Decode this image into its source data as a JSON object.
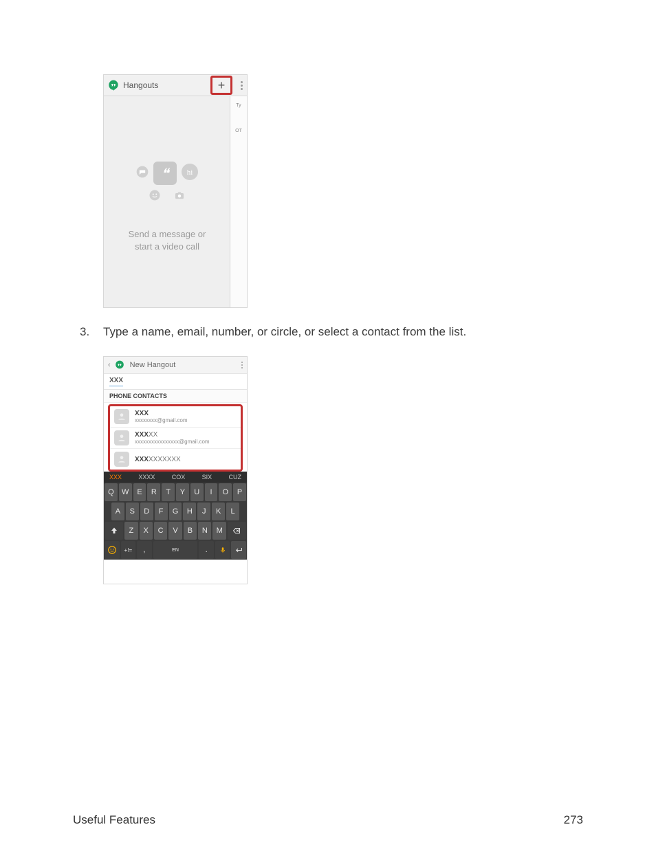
{
  "step": {
    "number": "3.",
    "text": "Type a name, email, number, or circle, or select a contact from the list."
  },
  "footer": {
    "section": "Useful Features",
    "page": "273"
  },
  "shot1": {
    "app_title": "Hangouts",
    "plus_glyph": "+",
    "side": {
      "top": "Ty",
      "section": "OT"
    },
    "hi": "hi",
    "msg_line1": "Send a message or",
    "msg_line2": "start a video call"
  },
  "shot2": {
    "app_title": "New Hangout",
    "search_value": "XXX",
    "section_header": "PHONE CONTACTS",
    "contacts": [
      {
        "name_bold": "XXX",
        "name_light": "",
        "email": "xxxxxxxx@gmail.com"
      },
      {
        "name_bold": "XXX",
        "name_light": "XX",
        "email": "xxxxxxxxxxxxxxxx@gmail.com"
      },
      {
        "name_bold": "XXX",
        "name_light": "XXXXXXX",
        "email": ""
      }
    ],
    "suggestions": [
      "XXX",
      "XXXX",
      "COX",
      "SIX",
      "CUZ"
    ],
    "rows": {
      "r1": [
        "Q",
        "W",
        "E",
        "R",
        "T",
        "Y",
        "U",
        "I",
        "O",
        "P"
      ],
      "r2": [
        "A",
        "S",
        "D",
        "F",
        "G",
        "H",
        "J",
        "K",
        "L"
      ],
      "r3": [
        "Z",
        "X",
        "C",
        "V",
        "B",
        "N",
        "M"
      ],
      "bottom": {
        "sym": "+!=",
        "comma": ",",
        "space_label": "EN",
        "dot": "."
      }
    }
  }
}
